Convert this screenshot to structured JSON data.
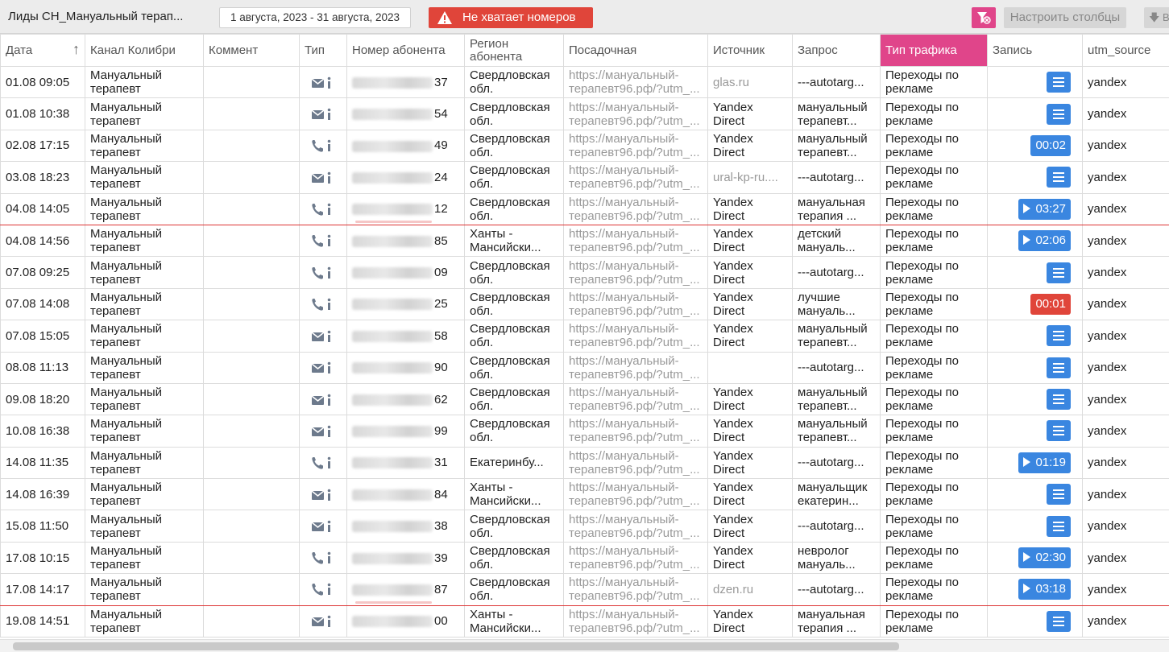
{
  "topbar": {
    "title": "Лиды СН_Мануальный терап...",
    "date_range": "1 августа, 2023 - 31 августа, 2023",
    "warning": "Не хватает номеров",
    "columns_button": "Настроить столбцы",
    "export_button": "В"
  },
  "columns": [
    "Дата",
    "Канал Колибри",
    "Коммент",
    "Тип",
    "Номер абонента",
    "Регион абонента",
    "Посадочная",
    "Источник",
    "Запрос",
    "Тип трафика",
    "Запись",
    "utm_source"
  ],
  "colors": {
    "accent_pink": "#e0458a",
    "warning_red": "#e0453a",
    "button_blue": "#3a86e0",
    "highlight_border": "#d33333"
  },
  "rows": [
    {
      "date": "01.08 09:05",
      "channel": "Мануальный терапевт",
      "type": "mail",
      "phone_end": "37",
      "region": "Свердловская обл.",
      "landing": "https://мануальный-терапевт96.рф/?utm_...",
      "source": "glas.ru",
      "source_grey": true,
      "query": "---autotarg...",
      "traffic": "Переходы по рекламе",
      "record": {
        "kind": "doc"
      },
      "utm": "yandex",
      "hl": false
    },
    {
      "date": "01.08 10:38",
      "channel": "Мануальный терапевт",
      "type": "mail",
      "phone_end": "54",
      "region": "Свердловская обл.",
      "landing": "https://мануальный-терапевт96.рф/?utm_...",
      "source": "Yandex Direct",
      "source_grey": false,
      "query": "мануальный терапевт...",
      "traffic": "Переходы по рекламе",
      "record": {
        "kind": "doc"
      },
      "utm": "yandex",
      "hl": false
    },
    {
      "date": "02.08 17:15",
      "channel": "Мануальный терапевт",
      "type": "call",
      "phone_end": "49",
      "region": "Свердловская обл.",
      "landing": "https://мануальный-терапевт96.рф/?utm_...",
      "source": "Yandex Direct",
      "source_grey": false,
      "query": "мануальный терапевт...",
      "traffic": "Переходы по рекламе",
      "record": {
        "kind": "time",
        "label": "00:02",
        "play": false,
        "red": false
      },
      "utm": "yandex",
      "hl": false
    },
    {
      "date": "03.08 18:23",
      "channel": "Мануальный терапевт",
      "type": "mail",
      "phone_end": "24",
      "region": "Свердловская обл.",
      "landing": "https://мануальный-терапевт96.рф/?utm_...",
      "source": "ural-kp-ru....",
      "source_grey": true,
      "query": "---autotarg...",
      "traffic": "Переходы по рекламе",
      "record": {
        "kind": "doc"
      },
      "utm": "yandex",
      "hl": false
    },
    {
      "date": "04.08 14:05",
      "channel": "Мануальный терапевт",
      "type": "call",
      "phone_end": "12",
      "region": "Свердловская обл.",
      "landing": "https://мануальный-терапевт96.рф/?utm_...",
      "source": "Yandex Direct",
      "source_grey": false,
      "query": "мануальная терапия ...",
      "traffic": "Переходы по рекламе",
      "record": {
        "kind": "time",
        "label": "03:27",
        "play": true,
        "red": false
      },
      "utm": "yandex",
      "hl": true
    },
    {
      "date": "04.08 14:56",
      "channel": "Мануальный терапевт",
      "type": "call",
      "phone_end": "85",
      "region": "Ханты - Мансийски...",
      "landing": "https://мануальный-терапевт96.рф/?utm_...",
      "source": "Yandex Direct",
      "source_grey": false,
      "query": "детский мануаль...",
      "traffic": "Переходы по рекламе",
      "record": {
        "kind": "time",
        "label": "02:06",
        "play": true,
        "red": false
      },
      "utm": "yandex",
      "hl": false
    },
    {
      "date": "07.08 09:25",
      "channel": "Мануальный терапевт",
      "type": "call",
      "phone_end": "09",
      "region": "Свердловская обл.",
      "landing": "https://мануальный-терапевт96.рф/?utm_...",
      "source": "Yandex Direct",
      "source_grey": false,
      "query": "---autotarg...",
      "traffic": "Переходы по рекламе",
      "record": {
        "kind": "doc"
      },
      "utm": "yandex",
      "hl": false
    },
    {
      "date": "07.08 14:08",
      "channel": "Мануальный терапевт",
      "type": "call",
      "phone_end": "25",
      "region": "Свердловская обл.",
      "landing": "https://мануальный-терапевт96.рф/?utm_...",
      "source": "Yandex Direct",
      "source_grey": false,
      "query": "лучшие мануаль...",
      "traffic": "Переходы по рекламе",
      "record": {
        "kind": "time",
        "label": "00:01",
        "play": false,
        "red": true
      },
      "utm": "yandex",
      "hl": false
    },
    {
      "date": "07.08 15:05",
      "channel": "Мануальный терапевт",
      "type": "mail",
      "phone_end": "58",
      "region": "Свердловская обл.",
      "landing": "https://мануальный-терапевт96.рф/?utm_...",
      "source": "Yandex Direct",
      "source_grey": false,
      "query": "мануальный терапевт...",
      "traffic": "Переходы по рекламе",
      "record": {
        "kind": "doc"
      },
      "utm": "yandex",
      "hl": false
    },
    {
      "date": "08.08 11:13",
      "channel": "Мануальный терапевт",
      "type": "mail",
      "phone_end": "90",
      "region": "Свердловская обл.",
      "landing": "https://мануальный-терапевт96.рф/?utm_...",
      "source": "",
      "source_grey": false,
      "query": "---autotarg...",
      "traffic": "Переходы по рекламе",
      "record": {
        "kind": "doc"
      },
      "utm": "yandex",
      "hl": false
    },
    {
      "date": "09.08 18:20",
      "channel": "Мануальный терапевт",
      "type": "mail",
      "phone_end": "62",
      "region": "Свердловская обл.",
      "landing": "https://мануальный-терапевт96.рф/?utm_...",
      "source": "Yandex Direct",
      "source_grey": false,
      "query": "мануальный терапевт...",
      "traffic": "Переходы по рекламе",
      "record": {
        "kind": "doc"
      },
      "utm": "yandex",
      "hl": false
    },
    {
      "date": "10.08 16:38",
      "channel": "Мануальный терапевт",
      "type": "mail",
      "phone_end": "99",
      "region": "Свердловская обл.",
      "landing": "https://мануальный-терапевт96.рф/?utm_...",
      "source": "Yandex Direct",
      "source_grey": false,
      "query": "мануальный терапевт...",
      "traffic": "Переходы по рекламе",
      "record": {
        "kind": "doc"
      },
      "utm": "yandex",
      "hl": false
    },
    {
      "date": "14.08 11:35",
      "channel": "Мануальный терапевт",
      "type": "call",
      "phone_end": "31",
      "region": "Екатеринбу...",
      "landing": "https://мануальный-терапевт96.рф/?utm_...",
      "source": "Yandex Direct",
      "source_grey": false,
      "query": "---autotarg...",
      "traffic": "Переходы по рекламе",
      "record": {
        "kind": "time",
        "label": "01:19",
        "play": true,
        "red": false
      },
      "utm": "yandex",
      "hl": false
    },
    {
      "date": "14.08 16:39",
      "channel": "Мануальный терапевт",
      "type": "mail",
      "phone_end": "84",
      "region": "Ханты - Мансийски...",
      "landing": "https://мануальный-терапевт96.рф/?utm_...",
      "source": "Yandex Direct",
      "source_grey": false,
      "query": "мануальщик екатерин...",
      "traffic": "Переходы по рекламе",
      "record": {
        "kind": "doc"
      },
      "utm": "yandex",
      "hl": false
    },
    {
      "date": "15.08 11:50",
      "channel": "Мануальный терапевт",
      "type": "mail",
      "phone_end": "38",
      "region": "Свердловская обл.",
      "landing": "https://мануальный-терапевт96.рф/?utm_...",
      "source": "Yandex Direct",
      "source_grey": false,
      "query": "---autotarg...",
      "traffic": "Переходы по рекламе",
      "record": {
        "kind": "doc"
      },
      "utm": "yandex",
      "hl": false
    },
    {
      "date": "17.08 10:15",
      "channel": "Мануальный терапевт",
      "type": "call",
      "phone_end": "39",
      "region": "Свердловская обл.",
      "landing": "https://мануальный-терапевт96.рф/?utm_...",
      "source": "Yandex Direct",
      "source_grey": false,
      "query": "невролог мануаль...",
      "traffic": "Переходы по рекламе",
      "record": {
        "kind": "time",
        "label": "02:30",
        "play": true,
        "red": false
      },
      "utm": "yandex",
      "hl": false
    },
    {
      "date": "17.08 14:17",
      "channel": "Мануальный терапевт",
      "type": "call",
      "phone_end": "87",
      "region": "Свердловская обл.",
      "landing": "https://мануальный-терапевт96.рф/?utm_...",
      "source": "dzen.ru",
      "source_grey": true,
      "query": "---autotarg...",
      "traffic": "Переходы по рекламе",
      "record": {
        "kind": "time",
        "label": "03:18",
        "play": true,
        "red": false
      },
      "utm": "yandex",
      "hl": true
    },
    {
      "date": "19.08 14:51",
      "channel": "Мануальный терапевт",
      "type": "mail",
      "phone_end": "00",
      "region": "Ханты - Мансийски...",
      "landing": "https://мануальный-терапевт96.рф/?utm_...",
      "source": "Yandex Direct",
      "source_grey": false,
      "query": "мануальная терапия ...",
      "traffic": "Переходы по рекламе",
      "record": {
        "kind": "doc"
      },
      "utm": "yandex",
      "hl": false
    }
  ]
}
